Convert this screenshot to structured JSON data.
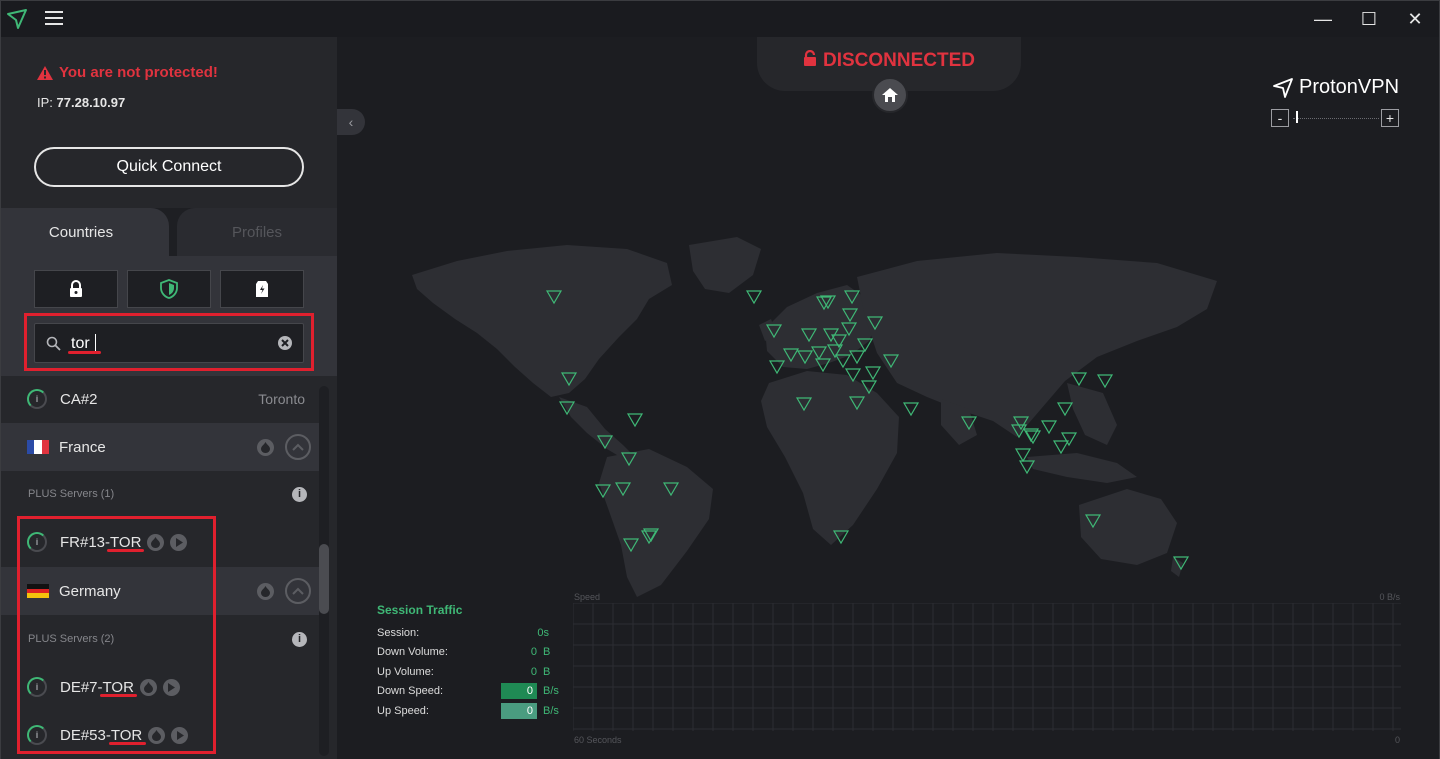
{
  "app": {
    "brand": "ProtonVPN",
    "colors": {
      "accent": "#3fb876",
      "danger": "#e0333f",
      "highlight": "#e0202e"
    }
  },
  "window": {
    "minimize": "—",
    "maximize": "☐",
    "close": "✕"
  },
  "status": {
    "warning": "You are not protected!",
    "ip_label": "IP:",
    "ip_value": "77.28.10.97",
    "connection": "DISCONNECTED"
  },
  "quick_connect": {
    "label": "Quick Connect"
  },
  "tabs": [
    {
      "label": "Countries",
      "active": true
    },
    {
      "label": "Profiles",
      "active": false
    }
  ],
  "filters": [
    {
      "icon": "lock-icon"
    },
    {
      "icon": "shield-icon"
    },
    {
      "icon": "p2p-icon"
    }
  ],
  "search": {
    "value": "tor"
  },
  "list": {
    "top_server": {
      "name": "CA#2",
      "city": "Toronto"
    },
    "countries": [
      {
        "name": "France",
        "group": "PLUS Servers (1)",
        "servers": [
          {
            "prefix": "FR#13-",
            "feature": "TOR"
          }
        ]
      },
      {
        "name": "Germany",
        "group": "PLUS Servers (2)",
        "servers": [
          {
            "prefix": "DE#7-",
            "feature": "TOR"
          },
          {
            "prefix": "DE#53-",
            "feature": "TOR"
          }
        ]
      }
    ]
  },
  "traffic": {
    "title": "Session Traffic",
    "session_label": "Session:",
    "session_value": "0s",
    "down_volume_label": "Down Volume:",
    "down_volume_value": "0",
    "down_volume_unit": "B",
    "up_volume_label": "Up Volume:",
    "up_volume_value": "0",
    "up_volume_unit": "B",
    "down_speed_label": "Down Speed:",
    "down_speed_value": "0",
    "down_speed_unit": "B/s",
    "up_speed_label": "Up Speed:",
    "up_speed_value": "0",
    "up_speed_unit": "B/s"
  },
  "graph": {
    "speed_label": "Speed",
    "speed_max": "0  B/s",
    "time_left": "60 Seconds",
    "time_right": "0"
  },
  "zoom": {
    "minus": "-",
    "plus": "+"
  }
}
